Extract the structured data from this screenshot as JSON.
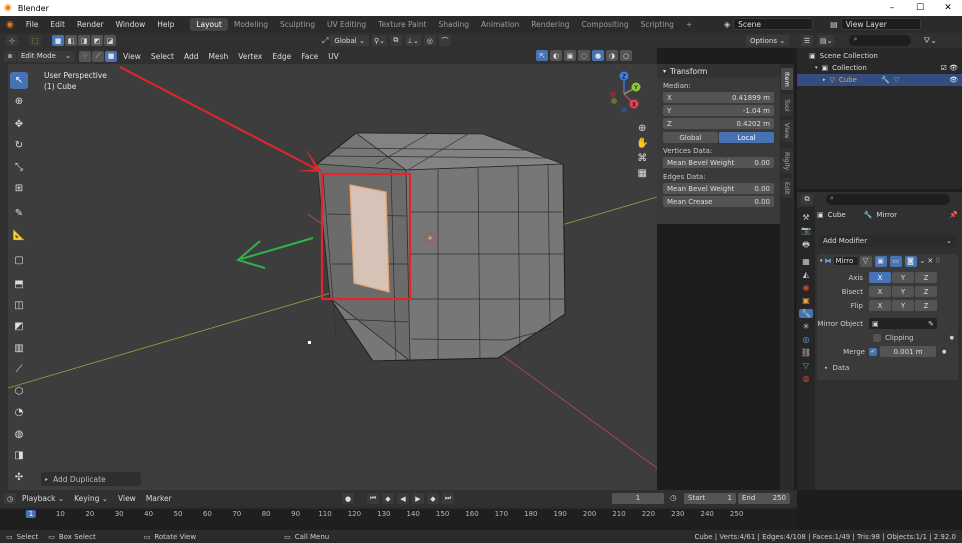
{
  "window": {
    "title": "Blender",
    "min": "–",
    "max": "☐",
    "close": "✕"
  },
  "topbar": {
    "menus": [
      "File",
      "Edit",
      "Render",
      "Window",
      "Help"
    ],
    "workspaces": [
      "Layout",
      "Modeling",
      "Sculpting",
      "UV Editing",
      "Texture Paint",
      "Shading",
      "Animation",
      "Rendering",
      "Compositing",
      "Scripting"
    ],
    "active_workspace": "Layout",
    "add_tab": "+",
    "scene": "Scene",
    "view_layer": "View Layer"
  },
  "header1": {
    "transform_orientation": "Global",
    "options": "Options"
  },
  "header2": {
    "mode": "Edit Mode",
    "menus": [
      "View",
      "Select",
      "Add",
      "Mesh",
      "Vertex",
      "Edge",
      "Face",
      "UV"
    ]
  },
  "viewport": {
    "perspective": "User Perspective",
    "object": "(1) Cube",
    "last_operator": "Add Duplicate",
    "gizmo": {
      "x": "X",
      "y": "Y",
      "z": "Z"
    },
    "colors": {
      "highlight": "#e0262b",
      "arrow_green": "#2fb34a",
      "x_axis": "#b84a55",
      "y_axis": "#8aa63f"
    }
  },
  "npanel": {
    "section": "Transform",
    "median_label": "Median:",
    "x_label": "X",
    "x_value": "0.41899 m",
    "y_label": "Y",
    "y_value": "-1.04 m",
    "z_label": "Z",
    "z_value": "0.4202 m",
    "global": "Global",
    "local": "Local",
    "vertices_data": "Vertices Data:",
    "mean_bevel_weight_label": "Mean Bevel Weight",
    "mean_bevel_weight_v": "0.00",
    "edges_data": "Edges Data:",
    "mean_bevel_weight_e_label": "Mean Bevel Weight",
    "mean_bevel_weight_e": "0.00",
    "mean_crease_label": "Mean Crease",
    "mean_crease": "0.00",
    "tabs": [
      "Item",
      "Tool",
      "View",
      "Rigify",
      "Edit"
    ]
  },
  "outliner": {
    "scene_collection": "Scene Collection",
    "collection": "Collection",
    "cube": "Cube"
  },
  "properties": {
    "object_name": "Cube",
    "modifier_name": "Mirror",
    "add_modifier": "Add Modifier",
    "mod_short": "Mirro",
    "axis_label": "Axis",
    "bisect_label": "Bisect",
    "flip_label": "Flip",
    "x": "X",
    "y": "Y",
    "z": "Z",
    "mirror_object_label": "Mirror Object",
    "clipping_label": "Clipping",
    "merge_label": "Merge",
    "merge_value": "0.001 m",
    "data_label": "Data"
  },
  "timeline": {
    "menus": [
      "Playback",
      "Keying",
      "View",
      "Marker"
    ],
    "current_frame": "1",
    "start_label": "Start",
    "start": "1",
    "end_label": "End",
    "end": "250",
    "ruler": [
      "1",
      "10",
      "20",
      "30",
      "40",
      "50",
      "60",
      "70",
      "80",
      "90",
      "110",
      "120",
      "130",
      "140",
      "150",
      "160",
      "170",
      "180",
      "190",
      "200",
      "210",
      "220",
      "230",
      "240",
      "250"
    ]
  },
  "statusbar": {
    "select": "Select",
    "box_select": "Box Select",
    "rotate_view": "Rotate View",
    "call_menu": "Call Menu",
    "stats": "Cube | Verts:4/61 | Edges:4/108 | Faces:1/49 | Tris:98 | Objects:1/1 | 2.92.0"
  }
}
